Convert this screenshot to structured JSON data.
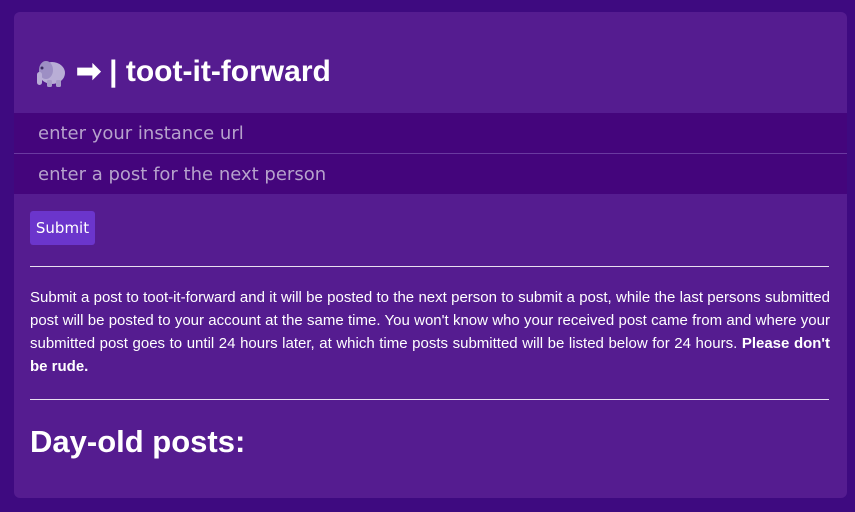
{
  "header": {
    "elephant_icon": "elephant-emoji-icon",
    "arrow_icon": "➡",
    "title": "| toot-it-forward"
  },
  "form": {
    "instance_placeholder": "enter your instance url",
    "instance_value": "",
    "post_placeholder": "enter a post for the next person",
    "post_value": "",
    "submit_label": "Submit"
  },
  "description": {
    "text": "Submit a post to toot-it-forward and it will be posted to the next person to submit a post, while the last persons submitted post will be posted to your account at the same time. You won't know who your received post came from and where your submitted post goes to until 24 hours later, at which time posts submitted will be listed below for 24 hours.",
    "emphasis": "Please don't be rude."
  },
  "posts": {
    "heading": "Day-old posts:"
  },
  "colors": {
    "page_background": "#3e0a80",
    "card_background": "#551c90",
    "input_background": "#44057c",
    "button_background": "#6b35cc",
    "text": "#ffffff"
  }
}
